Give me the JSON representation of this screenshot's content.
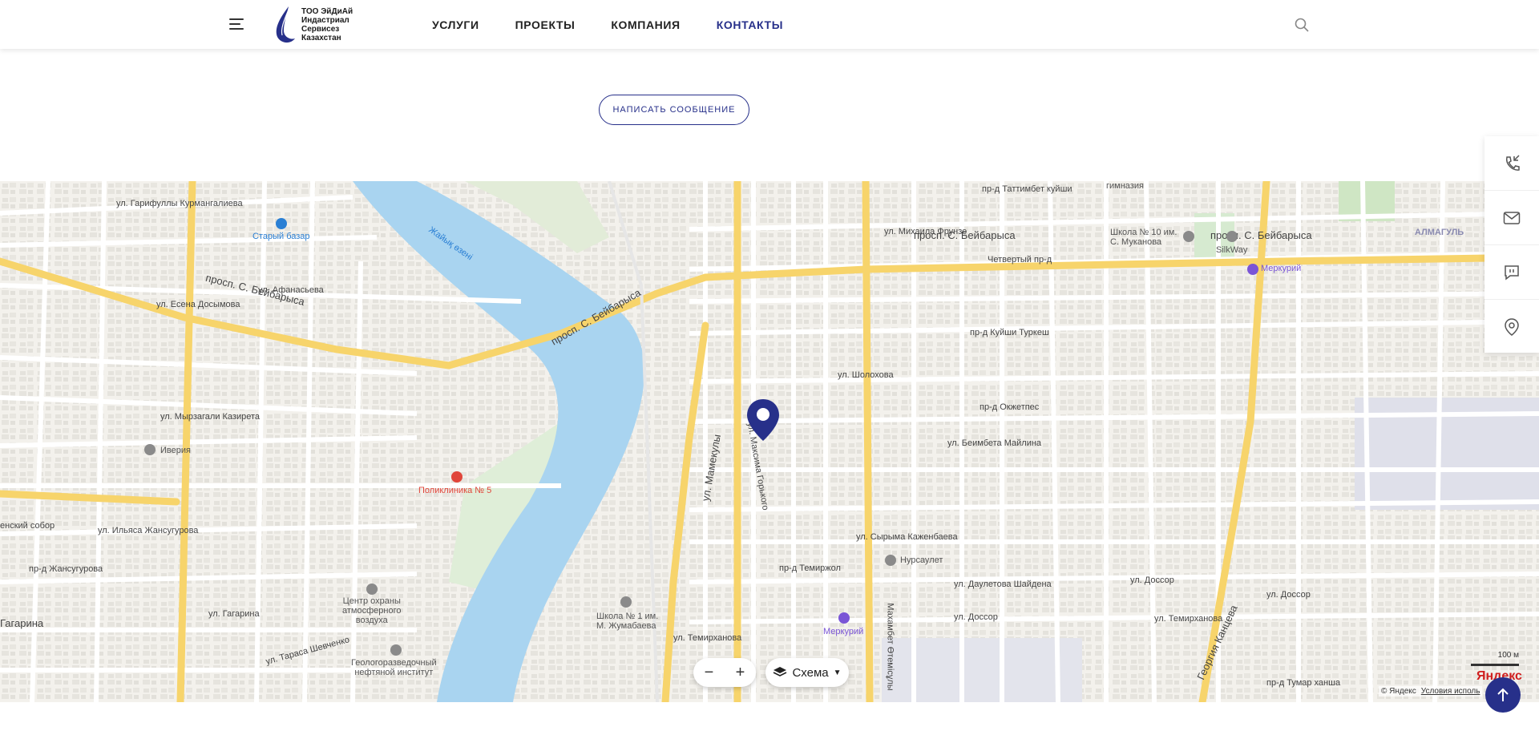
{
  "header": {
    "logo_text": "ТОО ЭйДиАй\nИндастриал\nСервисез\nКазахстан",
    "nav": [
      {
        "label": "УСЛУГИ",
        "active": false
      },
      {
        "label": "ПРОЕКТЫ",
        "active": false
      },
      {
        "label": "КОМПАНИЯ",
        "active": false
      },
      {
        "label": "КОНТАКТЫ",
        "active": true
      }
    ],
    "icons": {
      "menu": "hamburger-icon",
      "search": "search-icon"
    }
  },
  "cta": {
    "write_message": "НАПИСАТЬ СООБЩЕНИЕ"
  },
  "map": {
    "labels": {
      "river": "Жайық өзені",
      "avenue": "просп. С. Бейбарыса",
      "st_bazar": "Старый базар",
      "iveria": "Иверия",
      "poly5": "Поликлиника № 5",
      "center": "Центр охраны\nатмосферного\nвоздуха",
      "geo": "Геологоразведочный\nнефтяной институт",
      "school1": "Школа № 1 им.\nМ. Жумабаева",
      "merkuriy": "Меркурий",
      "nursaulet": "Нурсаулет",
      "school10": "Школа № 10 им.\nС. Муканова",
      "silkway": "SilkWay",
      "almagul": "АЛМАГУЛЬ",
      "gymnasium": "гимназия",
      "st_mamekuly": "ул. Мамекулы",
      "st_gorkogo": "ул. Максима Горького",
      "st_sholohova": "ул. Шолохова",
      "st_maylina": "ул. Беимбета Майлина",
      "st_kazhen": "ул. Сырыма Каженбаева",
      "st_temir": "ул. Темирханова",
      "st_dossor": "ул. Доссор",
      "st_frunze": "ул. Михаила Фрунзе",
      "st_makhambet": "Махамбет Өтемісұлы",
      "st_kantseva": "Георгия Канцева",
      "st_gagarina": "ул. Гагарина",
      "st_kurmangalieva": "ул. Гарифуллы Курмангалиева",
      "st_afanaseva": "ул. Афанасьева",
      "st_esenova": "ул. Есена Досымова",
      "st_kazireta": "ул. Мырзагали Казирета",
      "st_zhansugurova": "ул. Ильяса Жансугурова",
      "pr_zhansugurova": "пр-д Жансугурова",
      "pr_temirzhol": "пр-д Темиржол",
      "st_shaydena": "ул. Даулетова Шайдена",
      "pr_okzhetpes": "пр-д Окжетпес",
      "pr_kuyshi": "пр-д Куйши Туркеш",
      "pr_tattimbet": "пр-д Таттимбет куйши",
      "pr_chetvertiy": "Четвертый пр-д",
      "st_tumar": "пр-д Тумар ханша",
      "st_shevchenko": "ул. Тараса Шевченко",
      "st_beybarysa2": "просп. С. Бейбарыса",
      "sobor": "енский собор",
      "st_gagarina2": "Гагарина"
    },
    "layers_label": "Схема",
    "zoom_out": "−",
    "zoom_in": "+",
    "scale_label": "100 м",
    "yandex": "Яндекс",
    "copyright": "© Яндекс",
    "terms": "Условия исполь"
  },
  "side_panel": [
    "phone-icon",
    "mail-icon",
    "chat-icon",
    "location-icon"
  ],
  "colors": {
    "accent": "#27308a",
    "river": "#a9d4f0",
    "road_main": "#f7d46b"
  }
}
